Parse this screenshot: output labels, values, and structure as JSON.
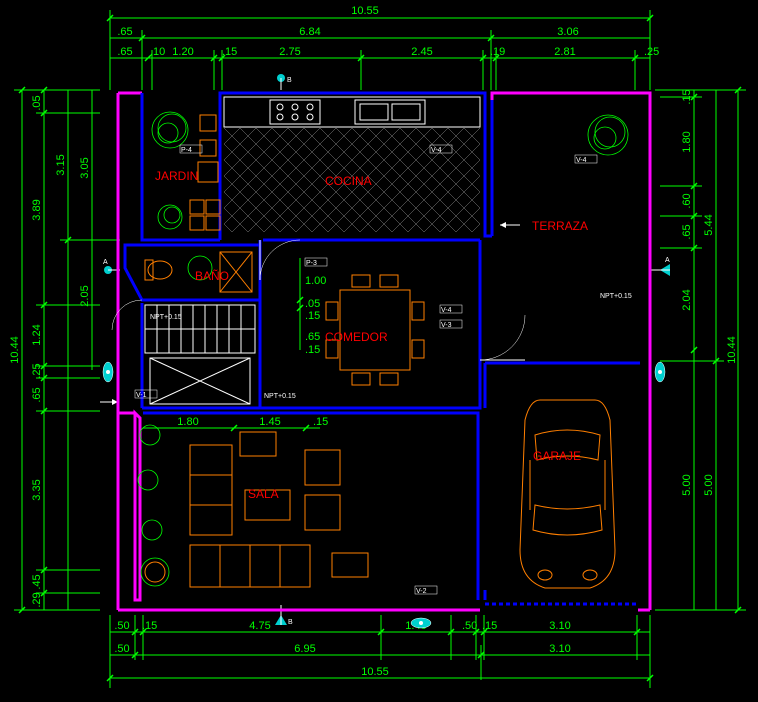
{
  "rooms": {
    "jardin": "JARDIN",
    "cocina": "COCINA",
    "terraza": "TERRAZA",
    "bano": "BAÑO",
    "comedor": "COMEDOR",
    "sala": "SALA",
    "garaje": "GARAJE"
  },
  "dims": {
    "overall_w": "10.55",
    "top_row1": {
      "a": ".65",
      "b": "6.84",
      "c": "3.06"
    },
    "top_row2": {
      "a": ".65",
      "b": ".10",
      "c": "1.20",
      "d": ".15",
      "e": "2.75",
      "f": "2.45",
      "g": ".19",
      "h": "2.81",
      "i": ".25"
    },
    "bottom_row1": {
      "a": ".50",
      "b": "6.95",
      "c": "3.10"
    },
    "bottom_row2": {
      "a": ".50",
      "b": ".15",
      "c": "4.75",
      "d": "1.40",
      "e": ".50",
      "f": ".15",
      "g": "3.10"
    },
    "overall_h": "10.44",
    "left_col1": {
      "a": ".29",
      "b": ".45",
      "c": "3.35",
      "d": ".65",
      "e": ".25",
      "f": "1.24",
      "g": "3.89",
      "h": ".05",
      "i": "3.15"
    },
    "left_col_inner": {
      "d1": "2.05",
      "d2": "3.05"
    },
    "right_col1": {
      "a": ".15",
      "b": "1.80",
      "c": ".60",
      "d": ".65",
      "e": "2.04",
      "f": "5.00"
    },
    "right_col2": {
      "a": "5.44",
      "b": "5.00"
    },
    "interior_center": {
      "a": "1.00",
      "b": ".05",
      "c": ".15",
      "d": ".65",
      "e": ".15"
    },
    "interior_bottom": {
      "a": "1.80",
      "b": "1.45",
      "c": ".15"
    },
    "marker_a": "A",
    "marker_b": "B",
    "npt_label": "NPT+0.15"
  }
}
